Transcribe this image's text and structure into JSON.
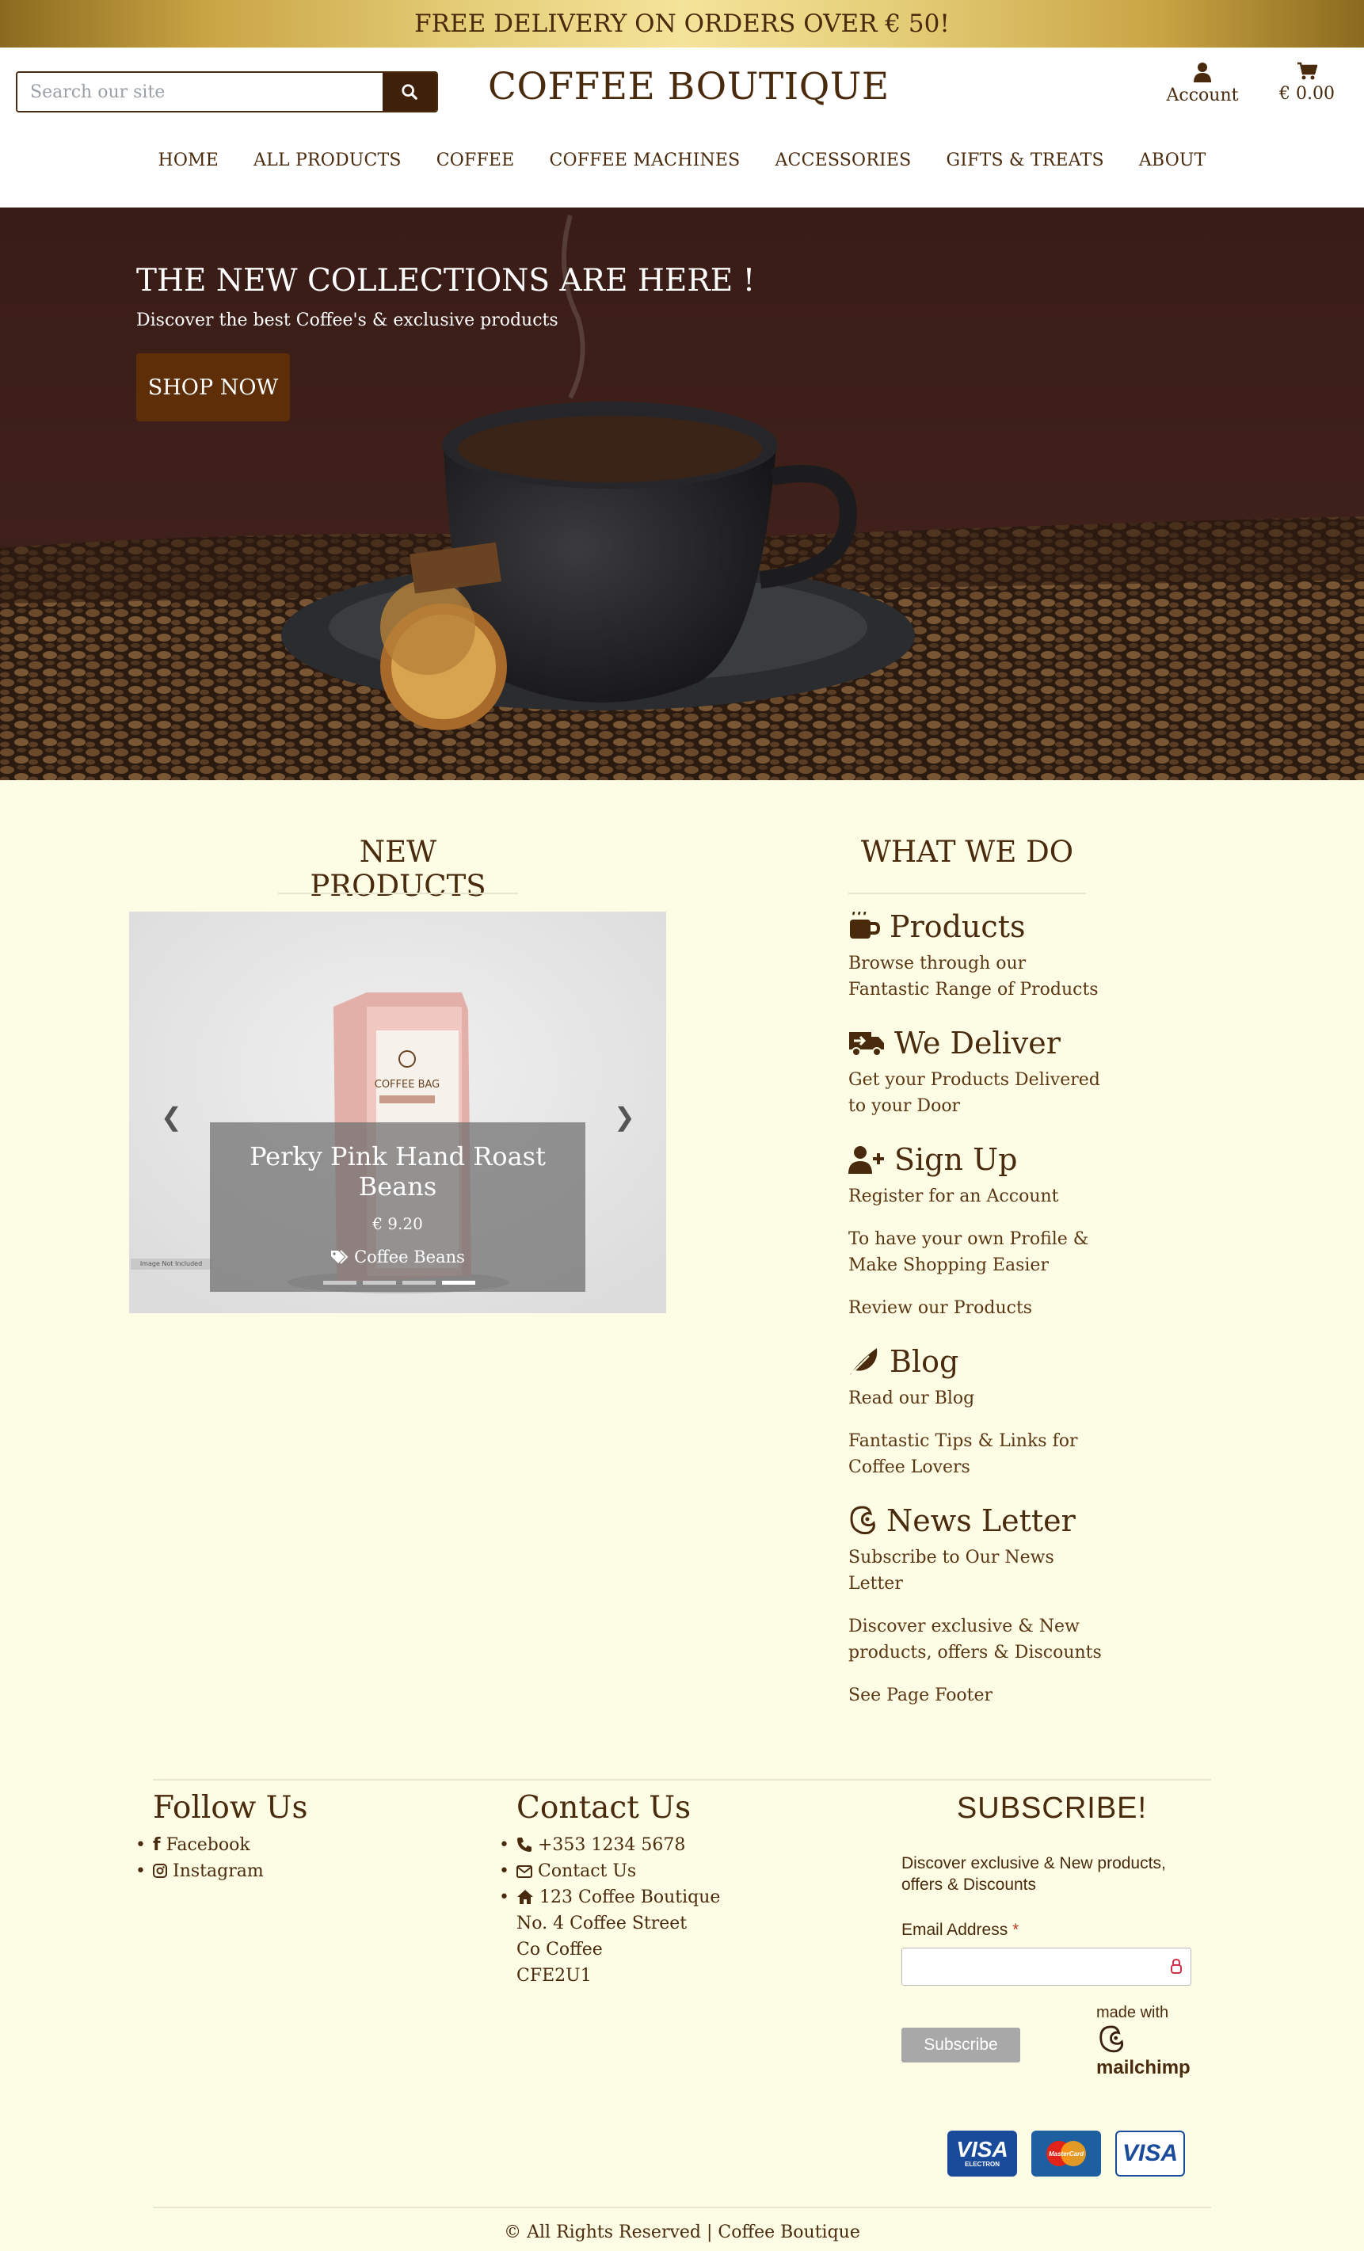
{
  "promo": {
    "text": "FREE DELIVERY ON ORDERS OVER € 50!"
  },
  "header": {
    "search_placeholder": "Search our site",
    "brand": "COFFEE BOUTIQUE",
    "account_label": "Account",
    "cart_total": "€ 0.00"
  },
  "nav": [
    "HOME",
    "ALL PRODUCTS",
    "COFFEE",
    "COFFEE MACHINES",
    "ACCESSORIES",
    "GIFTS & TREATS",
    "ABOUT"
  ],
  "hero": {
    "title": "THE NEW COLLECTIONS ARE HERE !",
    "subtitle": "Discover the best Coffee's & exclusive products",
    "button": "SHOP NOW"
  },
  "new_products": {
    "title": "NEW PRODUCTS",
    "slide": {
      "name": "Perky Pink Hand Roast Beans",
      "price": "€ 9.20",
      "category": "Coffee Beans",
      "bag_label": "COFFEE BAG"
    },
    "slide_count": 4,
    "active_slide": 4,
    "image_note": "Image Not Included"
  },
  "what_we_do": {
    "title": "WHAT WE DO",
    "blocks": [
      {
        "icon": "mug-icon",
        "heading": "Products",
        "lines": [
          "Browse through our Fantastic Range of Products"
        ]
      },
      {
        "icon": "truck-icon",
        "heading": "We Deliver",
        "lines": [
          "Get your Products Delivered to your Door"
        ]
      },
      {
        "icon": "user-plus-icon",
        "heading": "Sign Up",
        "lines": [
          "Register for an Account",
          "To have your own Profile & Make Shopping Easier",
          "Review our Products"
        ]
      },
      {
        "icon": "feather-icon",
        "heading": "Blog",
        "lines": [
          "Read our Blog",
          "Fantastic Tips & Links for Coffee Lovers"
        ]
      },
      {
        "icon": "mailchimp-icon",
        "heading": "News Letter",
        "lines": [
          "Subscribe to Our News Letter",
          "Discover exclusive & New products, offers & Discounts",
          "See Page Footer"
        ]
      }
    ]
  },
  "footer": {
    "follow": {
      "title": "Follow Us",
      "items": [
        "Facebook",
        "Instagram"
      ]
    },
    "contact": {
      "title": "Contact Us",
      "phone": "+353 1234 5678",
      "contact_link": "Contact Us",
      "address": [
        "123 Coffee Boutique",
        "No. 4 Coffee Street",
        "Co Coffee",
        "CFE2U1"
      ]
    },
    "subscribe": {
      "title": "SUBSCRIBE!",
      "desc": "Discover exclusive & New products, offers & Discounts",
      "email_label": "Email Address",
      "required_mark": "*",
      "button": "Subscribe",
      "made_with": "made with",
      "mailchimp": "mailchimp"
    },
    "cards": [
      "VISA",
      "MasterCard",
      "VISA"
    ],
    "card_sub": "ELECTRON",
    "copyright": "All Rights Reserved | Coffee Boutique"
  },
  "colors": {
    "brown": "#4a2a0c",
    "cream": "#fdfde6",
    "button_brown": "#5e2e08",
    "gold": "#e6cf7a"
  }
}
